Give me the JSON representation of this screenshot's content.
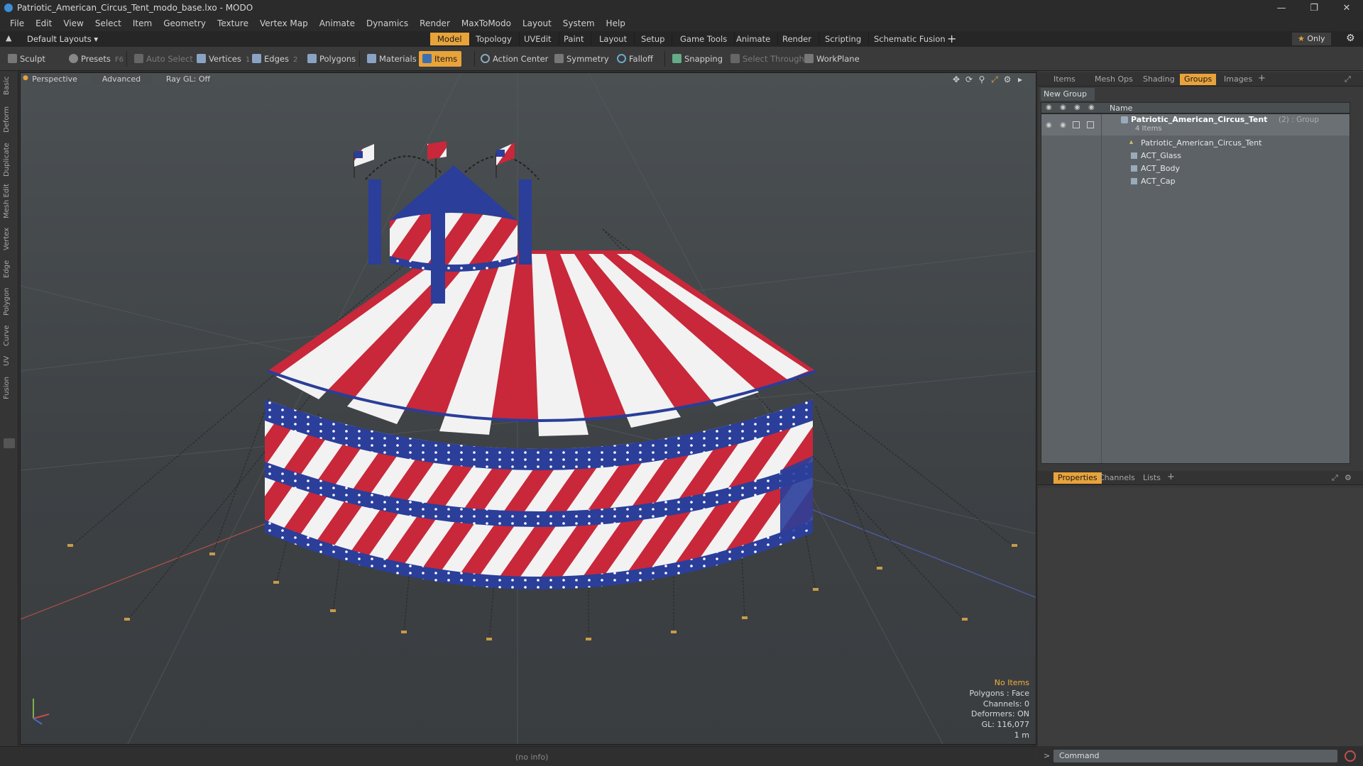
{
  "window": {
    "title": "Patriotic_American_Circus_Tent_modo_base.lxo - MODO"
  },
  "menu": [
    "File",
    "Edit",
    "View",
    "Select",
    "Item",
    "Geometry",
    "Texture",
    "Vertex Map",
    "Animate",
    "Dynamics",
    "Render",
    "MaxToModo",
    "Layout",
    "System",
    "Help"
  ],
  "layout_selector": "Default Layouts",
  "layout_tabs": [
    "Model",
    "Topology",
    "UVEdit",
    "Paint",
    "Layout",
    "Setup",
    "Game Tools",
    "Animate",
    "Render",
    "Scripting",
    "Schematic Fusion"
  ],
  "active_layout_tab": "Model",
  "only_label": "Only",
  "toolbar": {
    "sculpt": "Sculpt",
    "presets": "Presets",
    "presets_key": "F6",
    "auto_select": "Auto Select",
    "vertices": "Vertices",
    "vertices_count": "1",
    "edges": "Edges",
    "edges_count": "2",
    "polygons": "Polygons",
    "materials": "Materials",
    "items": "Items",
    "action_center": "Action Center",
    "symmetry": "Symmetry",
    "falloff": "Falloff",
    "snapping": "Snapping",
    "select_through": "Select Through",
    "workplane": "WorkPlane"
  },
  "left_tabs": [
    "Basic",
    "Deform",
    "Duplicate",
    "Mesh Edit",
    "Vertex",
    "Edge",
    "Polygon",
    "Curve",
    "UV",
    "Fusion"
  ],
  "viewport": {
    "view": "Perspective",
    "mode": "Advanced",
    "raygl": "Ray GL: Off",
    "stats": {
      "items": "No Items",
      "polygons": "Polygons : Face",
      "channels": "Channels: 0",
      "deformers": "Deformers: ON",
      "gl": "GL: 116,077",
      "unit": "1 m"
    }
  },
  "status": {
    "info": "(no info)"
  },
  "right_panel": {
    "tabs": [
      "Items",
      "Mesh Ops",
      "Shading",
      "Groups",
      "Images"
    ],
    "active_tab": "Groups",
    "new_group": "New Group",
    "column_name": "Name",
    "group": {
      "name": "Patriotic_American_Circus_Tent",
      "suffix": "(2) : Group",
      "count": "4 Items"
    },
    "children": [
      "Patriotic_American_Circus_Tent",
      "ACT_Glass",
      "ACT_Body",
      "ACT_Cap"
    ]
  },
  "bottom_panel": {
    "tabs": [
      "Properties",
      "Channels",
      "Lists"
    ],
    "active_tab": "Properties"
  },
  "command": {
    "placeholder": "Command"
  },
  "colors": {
    "accent": "#e8a33a",
    "tent_red": "#c8283a",
    "tent_blue": "#2a3e9a",
    "viewport_bg": "#43484b"
  }
}
